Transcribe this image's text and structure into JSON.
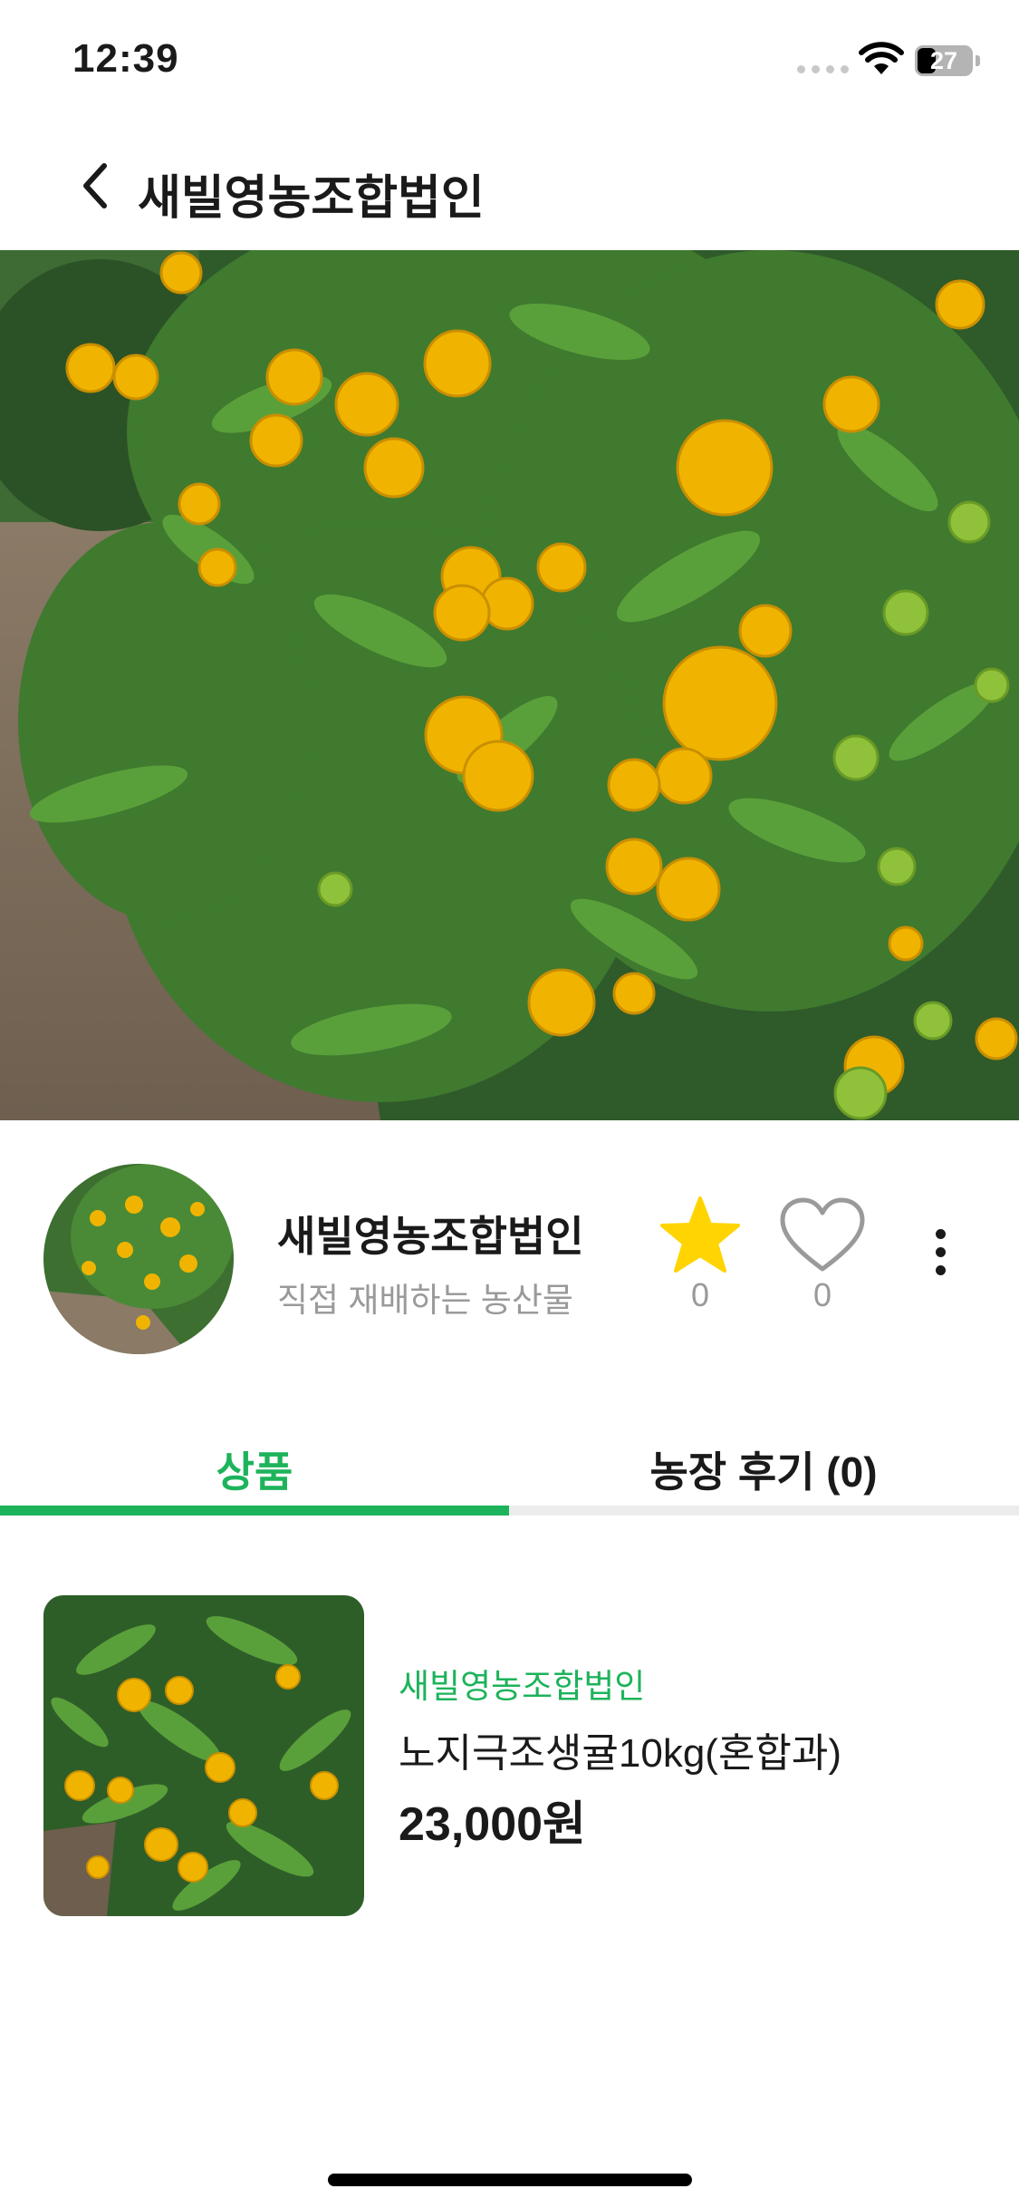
{
  "status_bar": {
    "time": "12:39",
    "battery": "27"
  },
  "nav": {
    "title": "새빌영농조합법인"
  },
  "profile": {
    "name": "새빌영농조합법인",
    "description": "직접 재배하는 농산물",
    "favorite_count": "0",
    "like_count": "0"
  },
  "tabs": {
    "products": "상품",
    "reviews": "농장 후기 (0)"
  },
  "product": {
    "farm": "새빌영농조합법인",
    "name": "노지극조생귤10kg(혼합과)",
    "price": "23,000원"
  },
  "colors": {
    "accent": "#1db35b",
    "star": "#ffd400",
    "muted": "#9a9a9a"
  },
  "icons": [
    "back-arrow-icon",
    "star-icon",
    "heart-icon",
    "more-vertical-icon",
    "wifi-icon",
    "battery-icon"
  ]
}
